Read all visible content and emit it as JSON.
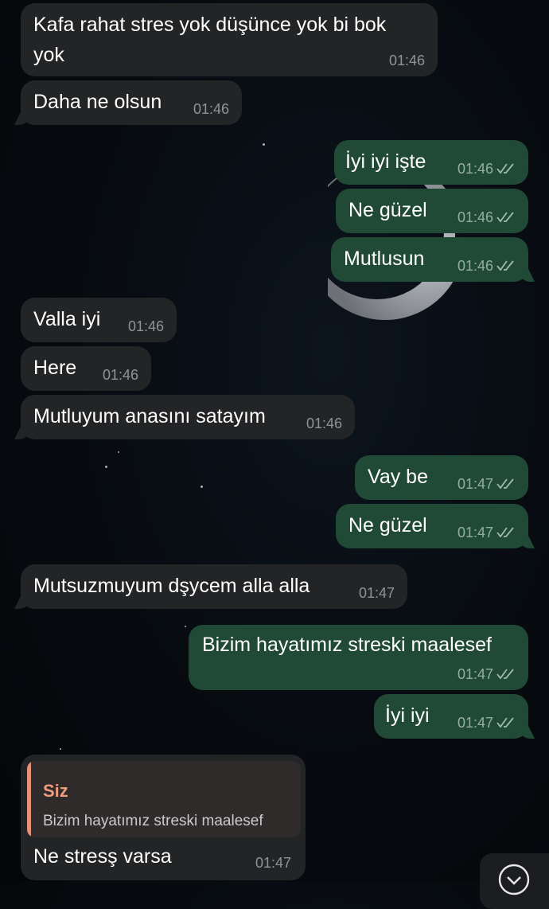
{
  "messages": [
    {
      "direction": "incoming",
      "lines": [
        "Kafa rahat stres yok düşünce yok bi bok",
        "yok"
      ],
      "time": "01:46"
    },
    {
      "direction": "incoming",
      "text": "Daha ne olsun",
      "time": "01:46"
    },
    {
      "direction": "outgoing",
      "text": "İyi iyi işte",
      "time": "01:46",
      "status": "read"
    },
    {
      "direction": "outgoing",
      "text": "Ne güzel",
      "time": "01:46",
      "status": "read"
    },
    {
      "direction": "outgoing",
      "text": "Mutlusun",
      "time": "01:46",
      "status": "read"
    },
    {
      "direction": "incoming",
      "text": "Valla iyi",
      "time": "01:46"
    },
    {
      "direction": "incoming",
      "text": "Here",
      "time": "01:46"
    },
    {
      "direction": "incoming",
      "text": "Mutluyum anasını satayım",
      "time": "01:46"
    },
    {
      "direction": "outgoing",
      "text": "Vay be",
      "time": "01:47",
      "status": "read"
    },
    {
      "direction": "outgoing",
      "text": "Ne güzel",
      "time": "01:47",
      "status": "read"
    },
    {
      "direction": "incoming",
      "text": "Mutsuzmuyum dşycem alla alla",
      "time": "01:47"
    },
    {
      "direction": "outgoing",
      "text": "Bizim hayatımız streski maalesef",
      "time": "01:47",
      "status": "read"
    },
    {
      "direction": "outgoing",
      "text": "İyi iyi",
      "time": "01:47",
      "status": "read"
    },
    {
      "direction": "incoming",
      "text": "Ne stresş varsa",
      "time": "01:47",
      "reply_to": {
        "author": "Siz",
        "text": "Bizim hayatımız streski maalesef"
      }
    }
  ],
  "colors": {
    "incoming_bubble": "#232426",
    "outgoing_bubble": "#204a36",
    "reply_accent": "#e6927a"
  },
  "icons": {
    "read_status": "double-check-icon",
    "scroll_down": "chevron-down-icon"
  }
}
